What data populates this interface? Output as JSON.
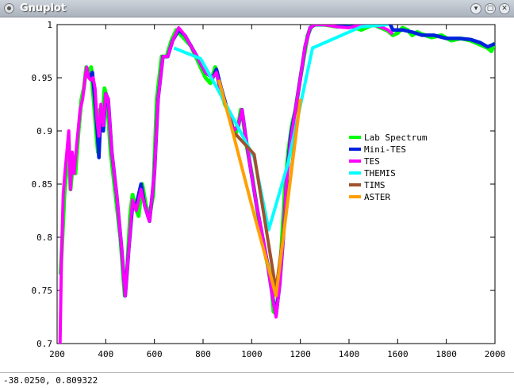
{
  "window": {
    "title": "Gnuplot",
    "buttons": [
      "chevron-down",
      "maximize",
      "close"
    ]
  },
  "status": {
    "coords": "-38.0250,  0.809322"
  },
  "chart_data": {
    "type": "line",
    "title": "",
    "xlabel": "",
    "ylabel": "",
    "xlim": [
      200,
      2000
    ],
    "ylim": [
      0.7,
      1.0
    ],
    "xticks": [
      "200",
      "400",
      "600",
      "800",
      "1000",
      "1200",
      "1400",
      "1600",
      "1800",
      "2000"
    ],
    "yticks": [
      "0.7",
      "0.75",
      "0.8",
      "0.85",
      "0.9",
      "0.95",
      "1"
    ],
    "grid": false,
    "legend_position": "right",
    "series": [
      {
        "name": "Lab Spectrum",
        "color": "#00ff00",
        "points": [
          [
            214,
            0.765
          ],
          [
            222,
            0.8
          ],
          [
            230,
            0.84
          ],
          [
            240,
            0.87
          ],
          [
            248,
            0.89
          ],
          [
            255,
            0.845
          ],
          [
            265,
            0.87
          ],
          [
            275,
            0.86
          ],
          [
            288,
            0.9
          ],
          [
            300,
            0.93
          ],
          [
            310,
            0.94
          ],
          [
            320,
            0.96
          ],
          [
            330,
            0.955
          ],
          [
            340,
            0.96
          ],
          [
            350,
            0.93
          ],
          [
            360,
            0.9
          ],
          [
            368,
            0.88
          ],
          [
            375,
            0.92
          ],
          [
            385,
            0.905
          ],
          [
            395,
            0.94
          ],
          [
            405,
            0.93
          ],
          [
            420,
            0.88
          ],
          [
            440,
            0.84
          ],
          [
            460,
            0.8
          ],
          [
            478,
            0.745
          ],
          [
            488,
            0.77
          ],
          [
            500,
            0.82
          ],
          [
            510,
            0.84
          ],
          [
            520,
            0.83
          ],
          [
            535,
            0.82
          ],
          [
            550,
            0.85
          ],
          [
            565,
            0.83
          ],
          [
            580,
            0.82
          ],
          [
            595,
            0.84
          ],
          [
            610,
            0.93
          ],
          [
            630,
            0.97
          ],
          [
            650,
            0.97
          ],
          [
            670,
            0.985
          ],
          [
            690,
            0.995
          ],
          [
            710,
            0.99
          ],
          [
            730,
            0.985
          ],
          [
            750,
            0.98
          ],
          [
            770,
            0.97
          ],
          [
            790,
            0.96
          ],
          [
            810,
            0.95
          ],
          [
            830,
            0.945
          ],
          [
            850,
            0.96
          ],
          [
            870,
            0.94
          ],
          [
            890,
            0.925
          ],
          [
            910,
            0.915
          ],
          [
            930,
            0.895
          ],
          [
            945,
            0.905
          ],
          [
            955,
            0.92
          ],
          [
            965,
            0.91
          ],
          [
            980,
            0.885
          ],
          [
            1000,
            0.86
          ],
          [
            1020,
            0.83
          ],
          [
            1040,
            0.8
          ],
          [
            1060,
            0.78
          ],
          [
            1080,
            0.76
          ],
          [
            1090,
            0.73
          ],
          [
            1100,
            0.728
          ],
          [
            1110,
            0.75
          ],
          [
            1120,
            0.78
          ],
          [
            1135,
            0.84
          ],
          [
            1150,
            0.88
          ],
          [
            1165,
            0.905
          ],
          [
            1180,
            0.92
          ],
          [
            1200,
            0.95
          ],
          [
            1215,
            0.97
          ],
          [
            1230,
            0.99
          ],
          [
            1245,
            0.998
          ],
          [
            1260,
            1.0
          ],
          [
            1300,
            1.0
          ],
          [
            1350,
            0.998
          ],
          [
            1400,
            0.999
          ],
          [
            1450,
            0.995
          ],
          [
            1500,
            1.0
          ],
          [
            1530,
            0.997
          ],
          [
            1560,
            0.994
          ],
          [
            1580,
            0.99
          ],
          [
            1600,
            0.992
          ],
          [
            1620,
            0.997
          ],
          [
            1640,
            0.995
          ],
          [
            1660,
            0.99
          ],
          [
            1680,
            0.993
          ],
          [
            1700,
            0.991
          ],
          [
            1740,
            0.988
          ],
          [
            1780,
            0.99
          ],
          [
            1820,
            0.985
          ],
          [
            1860,
            0.987
          ],
          [
            1900,
            0.985
          ],
          [
            1940,
            0.981
          ],
          [
            1970,
            0.978
          ],
          [
            1985,
            0.975
          ],
          [
            2000,
            0.983
          ]
        ]
      },
      {
        "name": "Mini-TES",
        "color": "#0022dd",
        "points": [
          [
            330,
            0.95
          ],
          [
            345,
            0.955
          ],
          [
            355,
            0.93
          ],
          [
            365,
            0.9
          ],
          [
            372,
            0.875
          ],
          [
            380,
            0.92
          ],
          [
            390,
            0.9
          ],
          [
            400,
            0.935
          ],
          [
            410,
            0.93
          ],
          [
            425,
            0.88
          ],
          [
            445,
            0.84
          ],
          [
            465,
            0.79
          ],
          [
            480,
            0.745
          ],
          [
            495,
            0.79
          ],
          [
            510,
            0.83
          ],
          [
            525,
            0.83
          ],
          [
            545,
            0.85
          ],
          [
            560,
            0.83
          ],
          [
            580,
            0.815
          ],
          [
            600,
            0.86
          ],
          [
            615,
            0.93
          ],
          [
            635,
            0.97
          ],
          [
            655,
            0.97
          ],
          [
            675,
            0.985
          ],
          [
            700,
            0.995
          ],
          [
            725,
            0.99
          ],
          [
            750,
            0.98
          ],
          [
            780,
            0.968
          ],
          [
            810,
            0.955
          ],
          [
            840,
            0.95
          ],
          [
            855,
            0.958
          ],
          [
            875,
            0.94
          ],
          [
            900,
            0.92
          ],
          [
            925,
            0.9
          ],
          [
            945,
            0.905
          ],
          [
            960,
            0.92
          ],
          [
            975,
            0.895
          ],
          [
            995,
            0.865
          ],
          [
            1020,
            0.83
          ],
          [
            1045,
            0.8
          ],
          [
            1065,
            0.775
          ],
          [
            1085,
            0.745
          ],
          [
            1100,
            0.727
          ],
          [
            1115,
            0.755
          ],
          [
            1130,
            0.8
          ],
          [
            1145,
            0.86
          ],
          [
            1160,
            0.895
          ],
          [
            1180,
            0.92
          ],
          [
            1200,
            0.95
          ],
          [
            1220,
            0.98
          ],
          [
            1240,
            0.997
          ],
          [
            1260,
            1.0
          ],
          [
            1300,
            1.0
          ],
          [
            1350,
            0.999
          ],
          [
            1400,
            0.998
          ],
          [
            1450,
            1.0
          ],
          [
            1500,
            1.002
          ],
          [
            1540,
            1.003
          ],
          [
            1560,
            1.005
          ],
          [
            1580,
            0.995
          ],
          [
            1620,
            0.995
          ],
          [
            1660,
            0.993
          ],
          [
            1700,
            0.99
          ],
          [
            1750,
            0.99
          ],
          [
            1800,
            0.987
          ],
          [
            1850,
            0.987
          ],
          [
            1900,
            0.986
          ],
          [
            1940,
            0.983
          ],
          [
            1970,
            0.979
          ],
          [
            2000,
            0.982
          ]
        ]
      },
      {
        "name": "TES",
        "color": "#ff00ff",
        "points": [
          [
            212,
            0.7
          ],
          [
            218,
            0.78
          ],
          [
            225,
            0.84
          ],
          [
            232,
            0.86
          ],
          [
            240,
            0.88
          ],
          [
            248,
            0.9
          ],
          [
            255,
            0.845
          ],
          [
            262,
            0.88
          ],
          [
            270,
            0.86
          ],
          [
            282,
            0.89
          ],
          [
            295,
            0.92
          ],
          [
            305,
            0.93
          ],
          [
            315,
            0.95
          ],
          [
            322,
            0.96
          ],
          [
            330,
            0.95
          ],
          [
            338,
            0.948
          ],
          [
            348,
            0.95
          ],
          [
            356,
            0.94
          ],
          [
            364,
            0.91
          ],
          [
            372,
            0.895
          ],
          [
            380,
            0.925
          ],
          [
            390,
            0.905
          ],
          [
            400,
            0.935
          ],
          [
            410,
            0.93
          ],
          [
            425,
            0.88
          ],
          [
            445,
            0.84
          ],
          [
            465,
            0.79
          ],
          [
            480,
            0.745
          ],
          [
            495,
            0.79
          ],
          [
            510,
            0.835
          ],
          [
            525,
            0.825
          ],
          [
            545,
            0.845
          ],
          [
            560,
            0.83
          ],
          [
            580,
            0.815
          ],
          [
            600,
            0.86
          ],
          [
            615,
            0.93
          ],
          [
            635,
            0.97
          ],
          [
            655,
            0.97
          ],
          [
            675,
            0.985
          ],
          [
            700,
            0.997
          ],
          [
            725,
            0.99
          ],
          [
            750,
            0.98
          ],
          [
            780,
            0.968
          ],
          [
            810,
            0.955
          ],
          [
            840,
            0.95
          ],
          [
            855,
            0.955
          ],
          [
            875,
            0.935
          ],
          [
            900,
            0.92
          ],
          [
            925,
            0.9
          ],
          [
            945,
            0.905
          ],
          [
            960,
            0.92
          ],
          [
            975,
            0.895
          ],
          [
            995,
            0.865
          ],
          [
            1020,
            0.83
          ],
          [
            1045,
            0.8
          ],
          [
            1065,
            0.775
          ],
          [
            1085,
            0.745
          ],
          [
            1100,
            0.725
          ],
          [
            1115,
            0.755
          ],
          [
            1130,
            0.8
          ],
          [
            1145,
            0.86
          ],
          [
            1160,
            0.89
          ],
          [
            1180,
            0.92
          ],
          [
            1200,
            0.95
          ],
          [
            1220,
            0.98
          ],
          [
            1240,
            0.997
          ],
          [
            1260,
            1.0
          ],
          [
            1300,
            1.0
          ],
          [
            1350,
            0.998
          ],
          [
            1400,
            0.997
          ],
          [
            1450,
            1.0
          ],
          [
            1500,
            1.0
          ],
          [
            1540,
            0.997
          ],
          [
            1560,
            0.995
          ],
          [
            1580,
            0.991
          ]
        ]
      },
      {
        "name": "THEMIS",
        "color": "#00ffff",
        "points": [
          [
            680,
            0.978
          ],
          [
            790,
            0.968
          ],
          [
            870,
            0.935
          ],
          [
            1010,
            0.875
          ],
          [
            1070,
            0.807
          ],
          [
            1150,
            0.87
          ],
          [
            1250,
            0.978
          ],
          [
            1450,
            0.998
          ],
          [
            1560,
            1.0
          ]
        ]
      },
      {
        "name": "TIMS",
        "color": "#a0522d",
        "points": [
          [
            930,
            0.898
          ],
          [
            1010,
            0.878
          ],
          [
            1100,
            0.75
          ],
          [
            1200,
            0.93
          ]
        ]
      },
      {
        "name": "ASTER",
        "color": "#ffa000",
        "points": [
          [
            865,
            0.948
          ],
          [
            915,
            0.905
          ],
          [
            1000,
            0.83
          ],
          [
            1100,
            0.745
          ],
          [
            1200,
            0.93
          ]
        ]
      }
    ]
  }
}
